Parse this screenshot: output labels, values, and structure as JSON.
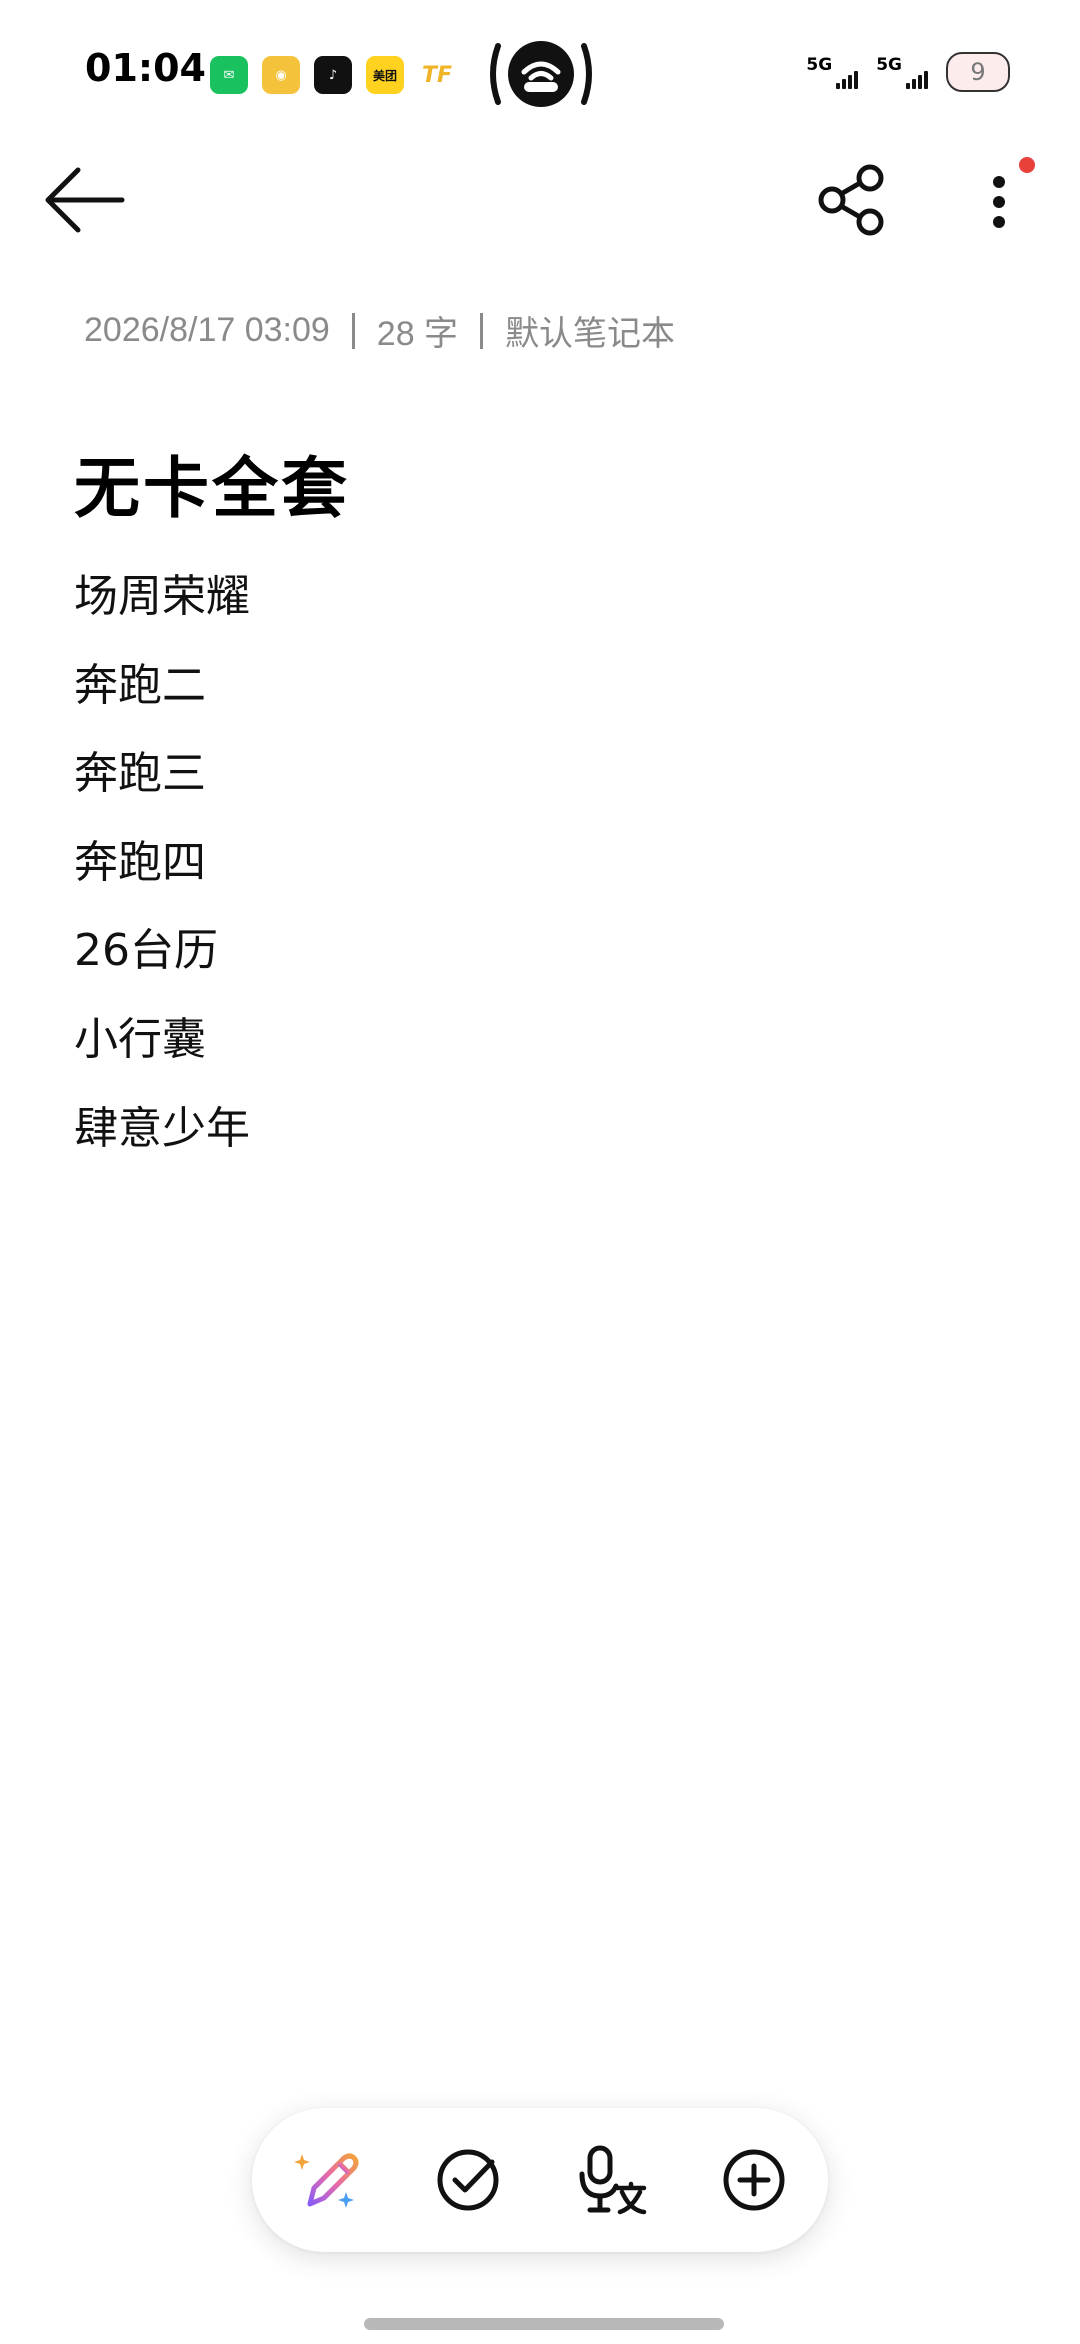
{
  "status_bar": {
    "time": "01:04",
    "apps": [
      {
        "name": "wechat",
        "label": "✉"
      },
      {
        "name": "weibo",
        "label": "◉"
      },
      {
        "name": "tiktok",
        "label": "♪"
      },
      {
        "name": "meituan",
        "label": "美团"
      },
      {
        "name": "tf",
        "label": "TF"
      }
    ],
    "network1": "5G",
    "network2": "5G",
    "battery": "9"
  },
  "note": {
    "timestamp": "2026/8/17 03:09",
    "word_count": "28 字",
    "notebook": "默认笔记本",
    "title": "无卡全套",
    "lines": [
      "场周荣耀",
      "奔跑二",
      "奔跑三",
      "奔跑四",
      "26台历",
      "小行囊",
      "肆意少年"
    ]
  },
  "colors": {
    "accent_notification": "#e8403a",
    "meta_text": "#8a8a8a"
  }
}
